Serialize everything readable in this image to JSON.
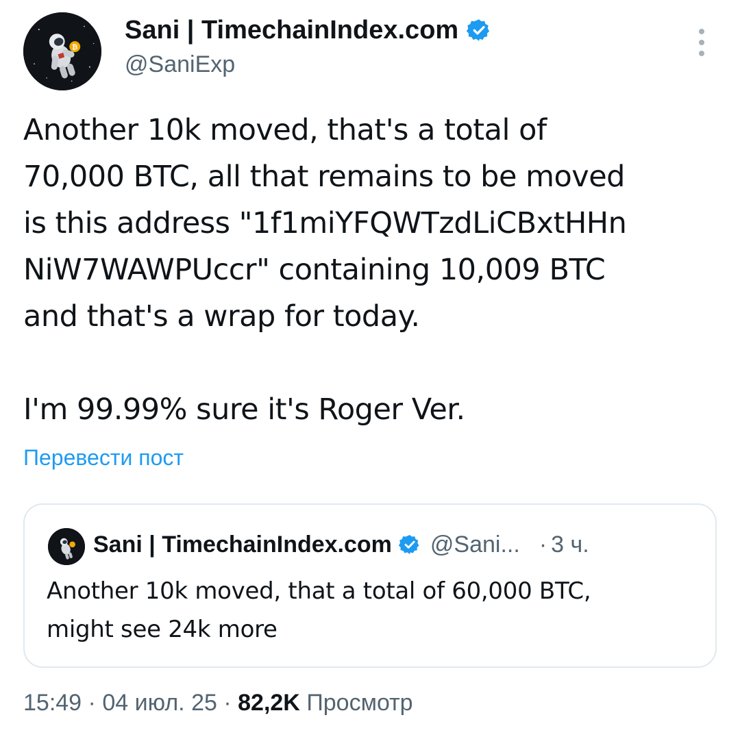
{
  "author": {
    "display_name": "Sani | TimechainIndex.com",
    "handle": "@SaniExp",
    "verified_icon": "verified-badge-icon",
    "avatar": "astronaut-avatar"
  },
  "post": {
    "text": "Another 10k moved, that's a total of\n70,000 BTC, all that remains to be moved\nis this address \"1f1miYFQWTzdLiCBxtHHn\nNiW7WAWPUccr\" containing 10,009 BTC\nand that's a wrap for today.\n\nI'm 99.99% sure it's Roger Ver.",
    "translate_label": "Перевести пост"
  },
  "quoted_post": {
    "display_name": "Sani | TimechainIndex.com",
    "handle": "@Sani...",
    "separator": "·",
    "time": "3 ч.",
    "text": "Another 10k moved, that a total of 60,000 BTC,\nmight see 24k more"
  },
  "meta": {
    "time": "15:49",
    "sep1": "·",
    "date": "04 июл. 25",
    "sep2": "·",
    "views_count": "82,2K",
    "views_label": "Просмотр"
  },
  "colors": {
    "accent": "#1d9bf0",
    "text_primary": "#0f1419",
    "text_secondary": "#536471",
    "border": "#e1e8ed"
  }
}
